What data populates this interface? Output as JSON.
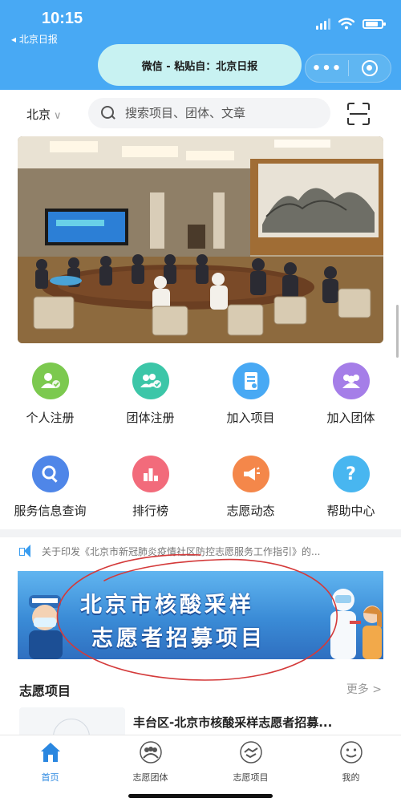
{
  "status_bar": {
    "time": "10:15",
    "back_app": "◂ 北京日报"
  },
  "mini_program": {
    "paste_notice": "微信 - 粘贴自：北京日报",
    "more_icon": "more-dots-icon",
    "close_icon": "target-circle-icon"
  },
  "search": {
    "city": "北京",
    "placeholder": "搜索项目、团体、文章"
  },
  "quick_actions": [
    {
      "label": "个人注册",
      "color": "#7cc94f",
      "icon": "person-check-icon"
    },
    {
      "label": "团体注册",
      "color": "#3cc6a8",
      "icon": "group-check-icon"
    },
    {
      "label": "加入项目",
      "color": "#48a9f4",
      "icon": "document-icon"
    },
    {
      "label": "加入团体",
      "color": "#a57ee8",
      "icon": "group-icon"
    },
    {
      "label": "服务信息查询",
      "color": "#4f86e8",
      "icon": "search-icon"
    },
    {
      "label": "排行榜",
      "color": "#f26b7b",
      "icon": "ranking-icon"
    },
    {
      "label": "志愿动态",
      "color": "#f4874a",
      "icon": "megaphone-icon"
    },
    {
      "label": "帮助中心",
      "color": "#48b6f0",
      "icon": "question-icon",
      "glyph": "?"
    }
  ],
  "notice": {
    "text": "关于印发《北京市新冠肺炎疫情社区防控志愿服务工作指引》的..."
  },
  "recruit_banner": {
    "line1": "北京市核酸采样",
    "line2": "志愿者招募项目"
  },
  "section": {
    "title": "志愿项目",
    "more": "更多 >"
  },
  "project": {
    "title": "丰台区-北京市核酸采样志愿者招募..."
  },
  "tabs": [
    {
      "label": "首页",
      "icon": "home-icon",
      "active": true
    },
    {
      "label": "志愿团体",
      "icon": "team-icon",
      "active": false
    },
    {
      "label": "志愿项目",
      "icon": "handshake-icon",
      "active": false
    },
    {
      "label": "我的",
      "icon": "smile-icon",
      "active": false
    }
  ]
}
